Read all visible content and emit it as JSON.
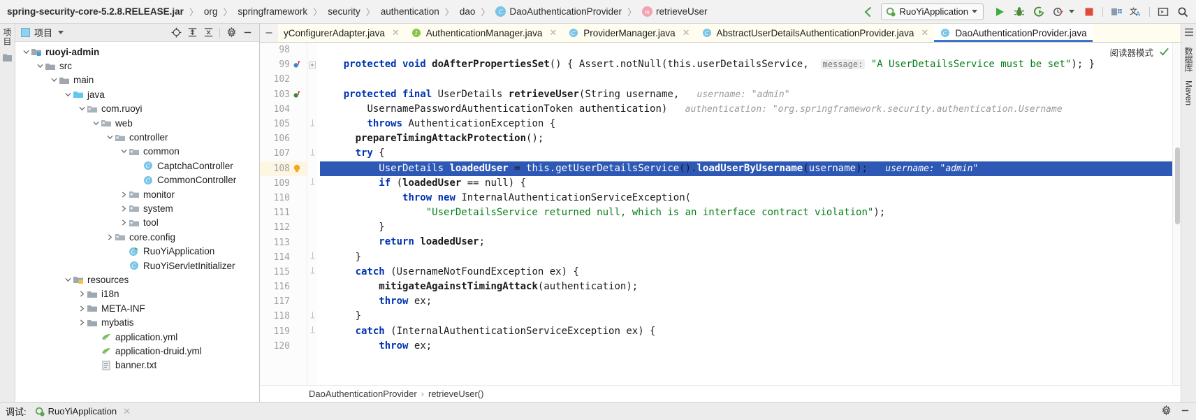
{
  "breadcrumbs": [
    {
      "label": "spring-security-core-5.2.8.RELEASE.jar",
      "bold": true,
      "icon": ""
    },
    {
      "label": "org",
      "bold": false,
      "icon": ""
    },
    {
      "label": "springframework",
      "bold": false,
      "icon": ""
    },
    {
      "label": "security",
      "bold": false,
      "icon": ""
    },
    {
      "label": "authentication",
      "bold": false,
      "icon": ""
    },
    {
      "label": "dao",
      "bold": false,
      "icon": ""
    },
    {
      "label": "DaoAuthenticationProvider",
      "bold": false,
      "icon": "class-icon"
    },
    {
      "label": "retrieveUser",
      "bold": false,
      "icon": "method-icon"
    }
  ],
  "toolbar": {
    "back_icon": "back-arrow-icon",
    "run_config": "RuoYiApplication",
    "run_icon": "run-icon",
    "debug_icon": "debug-icon",
    "run_coverage_icon": "run-with-coverage-icon",
    "profile_icon": "profiler-icon",
    "stop_icon": "stop-icon",
    "build_icon": "build-icon",
    "translate_icon": "translate-icon",
    "terminal_icon": "terminal-icon",
    "search_icon": "search-everywhere-icon"
  },
  "left_rail": {
    "label": "项目"
  },
  "right_rail": {
    "labels": [
      "数据库",
      "Maven"
    ]
  },
  "project_panel": {
    "title": "项目",
    "tools": [
      "locate-icon",
      "expand-all-icon",
      "collapse-all-icon",
      "settings-icon",
      "minimize-icon"
    ],
    "tree": [
      {
        "label": "ruoyi-admin",
        "depth": 0,
        "arrow": "down",
        "icon": "module-icon",
        "bold": true
      },
      {
        "label": "src",
        "depth": 1,
        "arrow": "down",
        "icon": "folder-icon",
        "bold": false
      },
      {
        "label": "main",
        "depth": 2,
        "arrow": "down",
        "icon": "folder-icon",
        "bold": false
      },
      {
        "label": "java",
        "depth": 3,
        "arrow": "down",
        "icon": "source-folder-icon",
        "bold": false
      },
      {
        "label": "com.ruoyi",
        "depth": 4,
        "arrow": "down",
        "icon": "package-icon",
        "bold": false
      },
      {
        "label": "web",
        "depth": 5,
        "arrow": "down",
        "icon": "package-icon",
        "bold": false
      },
      {
        "label": "controller",
        "depth": 6,
        "arrow": "down",
        "icon": "package-icon",
        "bold": false
      },
      {
        "label": "common",
        "depth": 7,
        "arrow": "down",
        "icon": "package-icon",
        "bold": false
      },
      {
        "label": "CaptchaController",
        "depth": 8,
        "arrow": "none",
        "icon": "class-icon",
        "bold": false
      },
      {
        "label": "CommonController",
        "depth": 8,
        "arrow": "none",
        "icon": "class-icon",
        "bold": false
      },
      {
        "label": "monitor",
        "depth": 7,
        "arrow": "right",
        "icon": "package-icon",
        "bold": false
      },
      {
        "label": "system",
        "depth": 7,
        "arrow": "right",
        "icon": "package-icon",
        "bold": false
      },
      {
        "label": "tool",
        "depth": 7,
        "arrow": "right",
        "icon": "package-icon",
        "bold": false
      },
      {
        "label": "core.config",
        "depth": 6,
        "arrow": "right",
        "icon": "package-icon",
        "bold": false
      },
      {
        "label": "RuoYiApplication",
        "depth": 7,
        "arrow": "none",
        "icon": "runnable-class-icon",
        "bold": false
      },
      {
        "label": "RuoYiServletInitializer",
        "depth": 7,
        "arrow": "none",
        "icon": "class-icon",
        "bold": false
      },
      {
        "label": "resources",
        "depth": 3,
        "arrow": "down",
        "icon": "resource-folder-icon",
        "bold": false
      },
      {
        "label": "i18n",
        "depth": 4,
        "arrow": "right",
        "icon": "folder-icon",
        "bold": false
      },
      {
        "label": "META-INF",
        "depth": 4,
        "arrow": "right",
        "icon": "folder-icon",
        "bold": false
      },
      {
        "label": "mybatis",
        "depth": 4,
        "arrow": "right",
        "icon": "folder-icon",
        "bold": false
      },
      {
        "label": "application.yml",
        "depth": 5,
        "arrow": "none",
        "icon": "yaml-icon",
        "bold": false
      },
      {
        "label": "application-druid.yml",
        "depth": 5,
        "arrow": "none",
        "icon": "yaml-icon",
        "bold": false
      },
      {
        "label": "banner.txt",
        "depth": 5,
        "arrow": "none",
        "icon": "text-icon",
        "bold": false
      }
    ]
  },
  "editor": {
    "tabs": [
      {
        "label": "yConfigurerAdapter.java",
        "icon": "",
        "active": false,
        "closable": true
      },
      {
        "label": "AuthenticationManager.java",
        "icon": "interface-icon",
        "active": false,
        "closable": true
      },
      {
        "label": "ProviderManager.java",
        "icon": "class-icon",
        "active": false,
        "closable": true
      },
      {
        "label": "AbstractUserDetailsAuthenticationProvider.java",
        "icon": "class-icon",
        "active": false,
        "closable": true
      },
      {
        "label": "DaoAuthenticationProvider.java",
        "icon": "class-icon",
        "active": true,
        "closable": false
      }
    ],
    "reader_mode_label": "阅读器模式",
    "inspection_icon": "inspections-ok-icon",
    "line_numbers": [
      "98",
      "99",
      "102",
      "103",
      "104",
      "105",
      "106",
      "107",
      "108",
      "109",
      "110",
      "111",
      "112",
      "113",
      "114",
      "115",
      "116",
      "117",
      "118",
      "119",
      "120"
    ],
    "selected_line": "108",
    "breadcrumb_bottom": [
      "DaoAuthenticationProvider",
      "retrieveUser()"
    ],
    "code_lines": [
      {
        "n": "98",
        "text": ""
      },
      {
        "n": "99",
        "text": "    protected void doAfterPropertiesSet() { Assert.notNull(this.userDetailsService,  message: \"A UserDetailsService must be set\"); }"
      },
      {
        "n": "102",
        "text": ""
      },
      {
        "n": "103",
        "text": "    protected final UserDetails retrieveUser(String username,   username: \"admin\""
      },
      {
        "n": "104",
        "text": "        UsernamePasswordAuthenticationToken authentication)   authentication: \"org.springframework.security.authentication.Username"
      },
      {
        "n": "105",
        "text": "        throws AuthenticationException {"
      },
      {
        "n": "106",
        "text": "      prepareTimingAttackProtection();"
      },
      {
        "n": "107",
        "text": "      try {"
      },
      {
        "n": "108",
        "text": "          UserDetails loadedUser = this.getUserDetailsService().loadUserByUsername(username);   username: \"admin\""
      },
      {
        "n": "109",
        "text": "          if (loadedUser == null) {"
      },
      {
        "n": "110",
        "text": "              throw new InternalAuthenticationServiceException("
      },
      {
        "n": "111",
        "text": "                  \"UserDetailsService returned null, which is an interface contract violation\");"
      },
      {
        "n": "112",
        "text": "          }"
      },
      {
        "n": "113",
        "text": "          return loadedUser;"
      },
      {
        "n": "114",
        "text": "      }"
      },
      {
        "n": "115",
        "text": "      catch (UsernameNotFoundException ex) {"
      },
      {
        "n": "116",
        "text": "          mitigateAgainstTimingAttack(authentication);"
      },
      {
        "n": "117",
        "text": "          throw ex;"
      },
      {
        "n": "118",
        "text": "      }"
      },
      {
        "n": "119",
        "text": "      catch (InternalAuthenticationServiceException ex) {"
      },
      {
        "n": "120",
        "text": "          throw ex;"
      }
    ]
  },
  "bottom_bar": {
    "debug_label": "调试:",
    "session_label": "RuoYiApplication",
    "settings_icon": "settings-icon",
    "minimize_icon": "minimize-icon"
  },
  "colors": {
    "selection_blue": "#2d58b5",
    "tab_active_underline": "#3c74c9",
    "tab_strip_bg": "#fffdef",
    "keyword": "#0033b3",
    "string": "#067d17",
    "field": "#871094",
    "hint_gray": "#9a9a9a"
  }
}
